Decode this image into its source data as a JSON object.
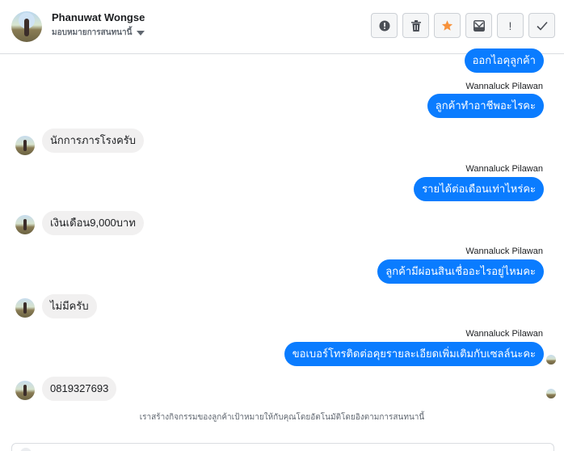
{
  "header": {
    "contact_name": "Phanuwat Wongse",
    "status_text": "มอบหมายการสนทนานี้"
  },
  "toolbar": {
    "buttons": [
      {
        "icon": "alert-circle-icon"
      },
      {
        "icon": "trash-icon"
      },
      {
        "icon": "star-icon",
        "color": "#f7923b"
      },
      {
        "icon": "archive-icon"
      },
      {
        "icon": "exclamation-icon",
        "label": "!"
      },
      {
        "icon": "check-icon"
      }
    ]
  },
  "messages": [
    {
      "direction": "out",
      "text": "ออกไอคุลูกค้า"
    },
    {
      "direction": "out",
      "sender": "Wannaluck Pilawan",
      "text": "ลูกค้าทำอาชีพอะไรคะ"
    },
    {
      "direction": "in",
      "text": "นักการภารโรงครับ"
    },
    {
      "direction": "out",
      "sender": "Wannaluck Pilawan",
      "text": "รายได้ต่อเดือนเท่าไหร่คะ"
    },
    {
      "direction": "in",
      "text": "เงินเดือน9,000บาท"
    },
    {
      "direction": "out",
      "sender": "Wannaluck Pilawan",
      "text": "ลูกค้ามีผ่อนสินเชื่ออะไรอยู่ไหมคะ"
    },
    {
      "direction": "in",
      "text": "ไม่มีครับ"
    },
    {
      "direction": "out",
      "sender": "Wannaluck Pilawan",
      "text": "ขอเบอร์โทรติดต่อคุยรายละเอียดเพิ่มเติมกับเซลล์นะคะ"
    },
    {
      "direction": "in",
      "text": "0819327693"
    }
  ],
  "footnote": "เราสร้างกิจกรรมของลูกค้าเป้าหมายให้กับคุณโดยอัตโนมัติโดยอิงตามการสนทนานี้",
  "colors": {
    "outgoing_bubble": "#0a7cff",
    "incoming_bubble": "#f1f0f0",
    "star": "#f7923b"
  }
}
